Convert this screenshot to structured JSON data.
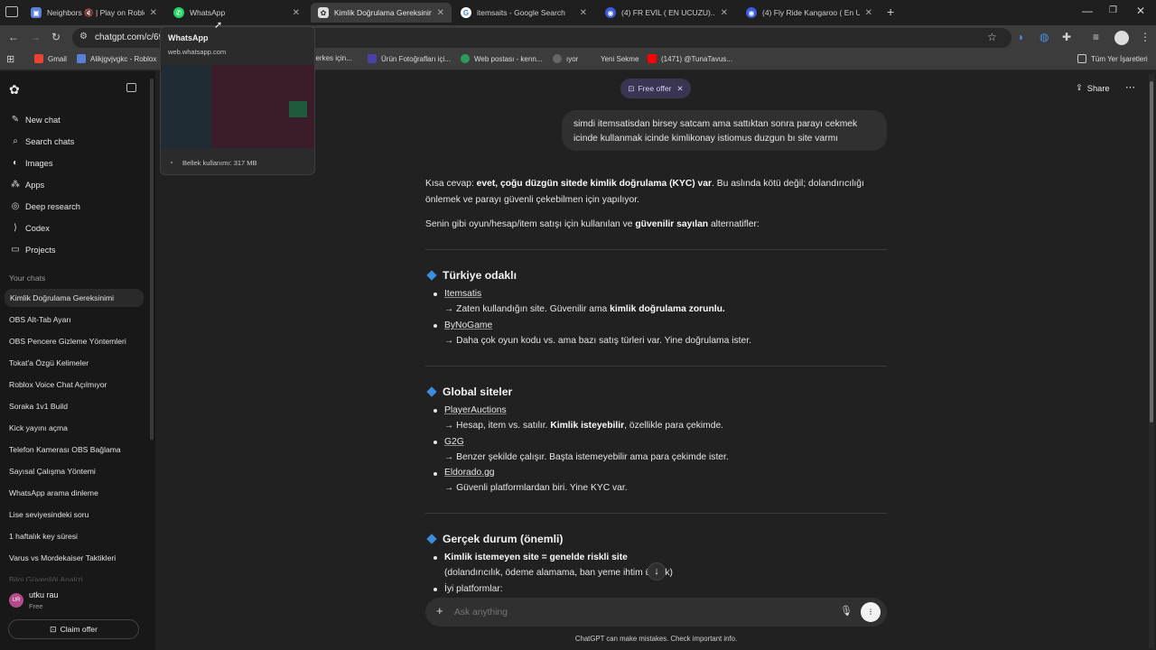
{
  "tabs": [
    {
      "title": "Neighbors 🔇 | Play on Roblox",
      "icon": "roblox-icon"
    },
    {
      "title": "WhatsApp",
      "icon": "whatsapp-icon"
    },
    {
      "title": "Kimlik Doğrulama Gereksinimi",
      "icon": "chatgpt-icon",
      "active": true
    },
    {
      "title": "itemsaits - Google Search",
      "icon": "google-icon"
    },
    {
      "title": "(4) FR EVİL ( EN UCUZU)..🔊",
      "icon": "twitch-icon"
    },
    {
      "title": "(4) Fly Ride Kangaroo ( En U",
      "icon": "twitch-icon"
    }
  ],
  "address": {
    "url": "chatgpt.com/c/69"
  },
  "tooltip": {
    "title": "WhatsApp",
    "url": "web.whatsapp.com",
    "memory": "Bellek kullanımı: 317 MB"
  },
  "bookmarks": {
    "items": [
      "Gmail",
      "Alikjgvjvgkc - Roblox",
      "herkes için...",
      "Ürün Fotoğrafları içi...",
      "Web postası - kenn...",
      "ıyor",
      "Yeni Sekme",
      "(1471) @TunaTavus..."
    ],
    "all_label": "Tüm Yer İşaretleri"
  },
  "sidebar": {
    "nav": [
      {
        "label": "New chat",
        "icon": "edit-icon"
      },
      {
        "label": "Search chats",
        "icon": "search-icon"
      },
      {
        "label": "Images",
        "icon": "image-icon"
      },
      {
        "label": "Apps",
        "icon": "apps-icon"
      },
      {
        "label": "Deep research",
        "icon": "research-icon"
      },
      {
        "label": "Codex",
        "icon": "code-icon"
      },
      {
        "label": "Projects",
        "icon": "folder-icon"
      }
    ],
    "your_chats": "Your chats",
    "chats": [
      "Kimlik Doğrulama Gereksinimi",
      "OBS Alt-Tab Ayarı",
      "OBS Pencere Gizleme Yöntemleri",
      "Tokat'a Özgü Kelimeler",
      "Roblox Voice Chat Açılmıyor",
      "Soraka 1v1 Build",
      "Kick yayını açma",
      "Telefon Kamerası OBS Bağlama",
      "Sayısal Çalışma Yöntemi",
      "WhatsApp arama dinleme",
      "Lise seviyesindeki soru",
      "1 haftalık key süresi",
      "Varus vs Mordekaiser Taktikleri",
      "Bilgi Güvenliği Analizi"
    ],
    "user": {
      "initials": "UR",
      "name": "utku rau",
      "plan": "Free"
    },
    "claim_offer": "Claim offer"
  },
  "header": {
    "free_offer": "Free offer",
    "share": "Share"
  },
  "conversation": {
    "user_message": [
      "simdi itemsatisdan birsey satcam ama sattıktan sonra parayı cekmek",
      "icinde kullanmak icinde kimlikonay istiomus duzgun bı site varmı"
    ],
    "intro1_a": "Kısa cevap: ",
    "intro1_b": "evet, çoğu düzgün sitede kimlik doğrulama (KYC) var",
    "intro1_c": ". Bu aslında kötü değil; dolandırıcılığı",
    "intro1_line2": "önlemek ve parayı güvenli çekebilmen için yapılıyor.",
    "intro2_a": "Senin gibi oyun/hesap/item satışı için kullanılan ve ",
    "intro2_b": "güvenilir sayılan",
    "intro2_c": " alternatifler:",
    "s1_title": "Türkiye odaklı",
    "s1_i1": "Itemsatis",
    "s1_i1_d_a": "→ Zaten kullandığın site. Güvenilir ama ",
    "s1_i1_d_b": "kimlik doğrulama zorunlu.",
    "s1_i2": "ByNoGame",
    "s1_i2_d": "→ Daha çok oyun kodu vs. ama bazı satış türleri var. Yine doğrulama ister.",
    "s2_title": "Global siteler",
    "s2_i1": "PlayerAuctions",
    "s2_i1_d_a": "→ Hesap, item vs. satılır. ",
    "s2_i1_d_b": "Kimlik isteyebilir",
    "s2_i1_d_c": ", özellikle para çekimde.",
    "s2_i2": "G2G",
    "s2_i2_d": "→ Benzer şekilde çalışır. Başta istemeyebilir ama para çekimde ister.",
    "s2_i3": "Eldorado.gg",
    "s2_i3_d": "→ Güvenli platformlardan biri. Yine KYC var.",
    "s3_title": "Gerçek durum (önemli)",
    "s3_i1": "Kimlik istemeyen site = genelde riskli site",
    "s3_i1_d": "(dolandırıcılık, ödeme alamama, ban yeme ihtim  üksek)",
    "s3_i2": "İyi platformlar:"
  },
  "composer": {
    "placeholder": "Ask anything",
    "disclaimer": "ChatGPT can make mistakes. Check important info."
  }
}
